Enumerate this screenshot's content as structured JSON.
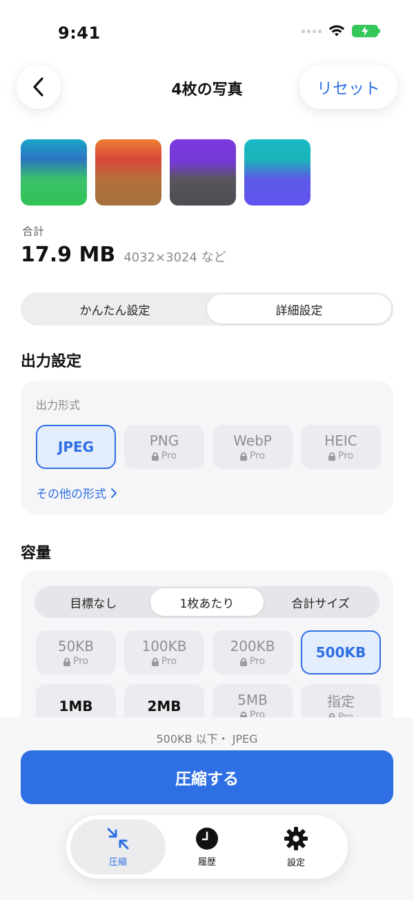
{
  "status": {
    "time": "9:41"
  },
  "nav": {
    "title": "4枚の写真",
    "reset_label": "リセット"
  },
  "photos": {
    "total_label": "合計",
    "total_size": "17.9 MB",
    "dimensions": "4032×3024 など"
  },
  "mode_tabs": [
    "かんたん設定",
    "詳細設定"
  ],
  "mode_selected": "詳細設定",
  "output": {
    "section_title": "出力設定",
    "format_label": "出力形式",
    "formats": [
      {
        "name": "JPEG",
        "pro": "",
        "selected": true
      },
      {
        "name": "PNG",
        "pro": "Pro",
        "selected": false
      },
      {
        "name": "WebP",
        "pro": "Pro",
        "selected": false
      },
      {
        "name": "HEIC",
        "pro": "Pro",
        "selected": false
      }
    ],
    "more_formats": "その他の形式"
  },
  "capacity": {
    "section_title": "容量",
    "tabs": [
      "目標なし",
      "1枚あたり",
      "合計サイズ"
    ],
    "tab_selected": "1枚あたり",
    "sizes": [
      {
        "name": "50KB",
        "pro": "Pro",
        "selected": false
      },
      {
        "name": "100KB",
        "pro": "Pro",
        "selected": false
      },
      {
        "name": "200KB",
        "pro": "Pro",
        "selected": false
      },
      {
        "name": "500KB",
        "pro": "",
        "selected": true
      },
      {
        "name": "1MB",
        "pro": "",
        "selected": false
      },
      {
        "name": "2MB",
        "pro": "",
        "selected": false
      },
      {
        "name": "5MB",
        "pro": "Pro",
        "selected": false
      },
      {
        "name": "指定",
        "pro": "Pro",
        "selected": false
      }
    ]
  },
  "footer": {
    "summary": "500KB 以下・ JPEG",
    "compress_label": "圧縮する",
    "tabs": [
      {
        "label": "圧縮",
        "icon": "compress-arrows-icon",
        "active": true
      },
      {
        "label": "履歴",
        "icon": "clock-icon",
        "active": false
      },
      {
        "label": "設定",
        "icon": "gear-icon",
        "active": false
      }
    ]
  },
  "colors": {
    "accent": "#2f6fe4",
    "battery": "#34c759"
  }
}
